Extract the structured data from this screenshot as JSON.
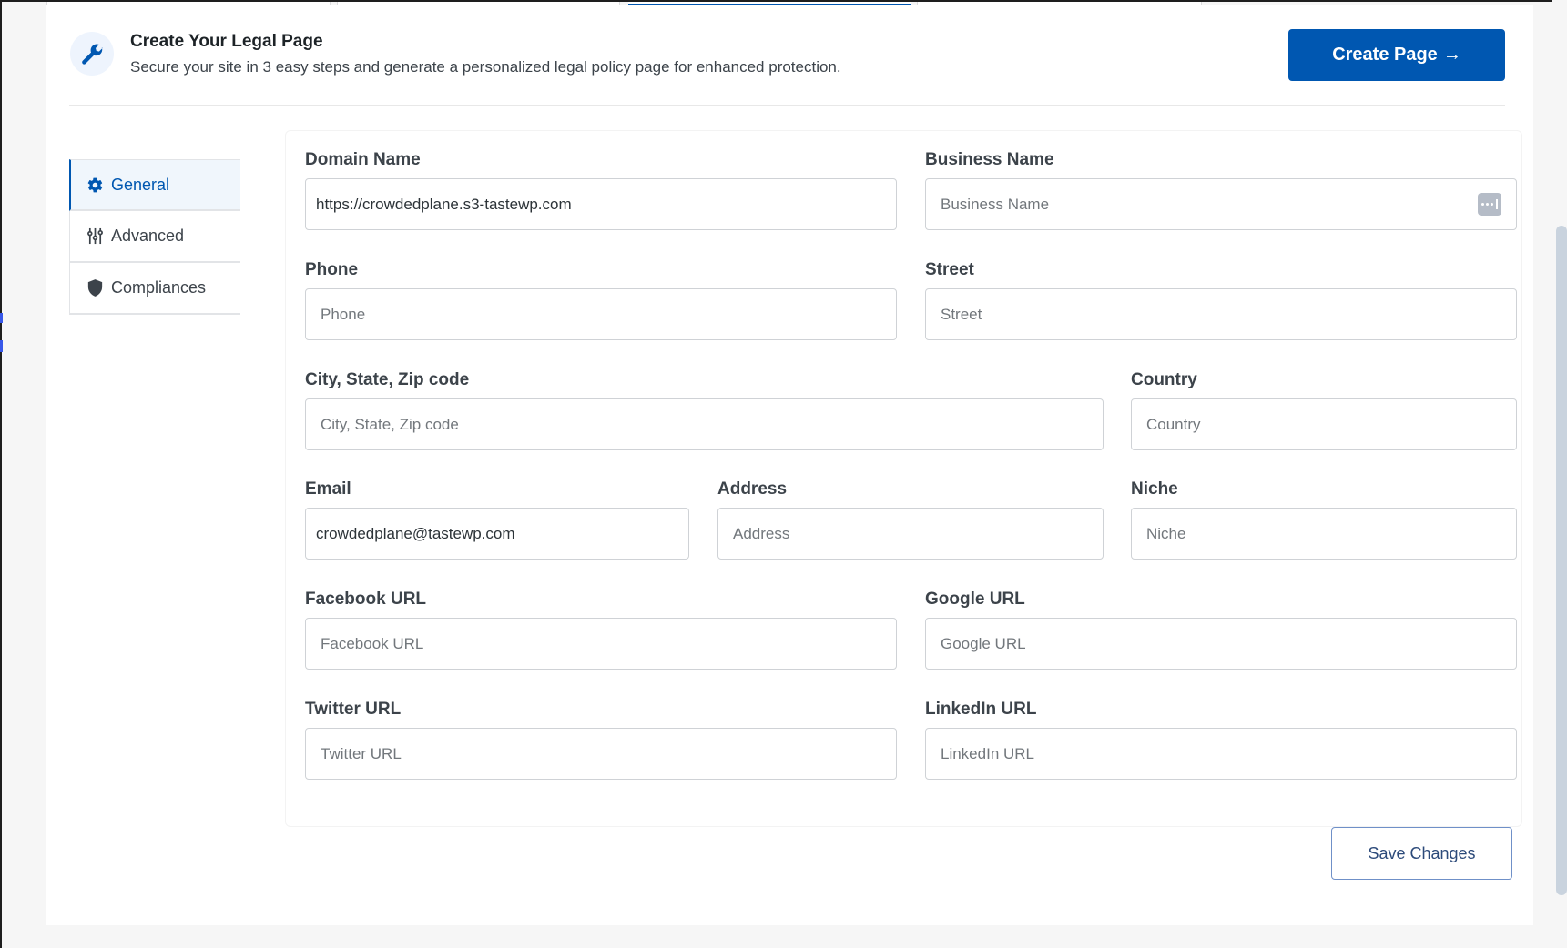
{
  "top_tabs": [
    {
      "label": "",
      "active": false
    },
    {
      "label": "",
      "active": false
    },
    {
      "label": "",
      "active": true
    },
    {
      "label": "",
      "active": false
    }
  ],
  "header": {
    "icon": "wrench-icon",
    "title": "Create Your Legal Page",
    "subtitle": "Secure your site in 3 easy steps and generate a personalized legal policy page for enhanced protection.",
    "create_button": "Create Page",
    "create_button_arrow": "→"
  },
  "sidebar": {
    "items": [
      {
        "label": "General",
        "icon": "gear-icon",
        "active": true
      },
      {
        "label": "Advanced",
        "icon": "sliders-icon",
        "active": false
      },
      {
        "label": "Compliances",
        "icon": "shield-icon",
        "active": false
      }
    ]
  },
  "form": {
    "domain_name": {
      "label": "Domain Name",
      "value": "https://crowdedplane.s3-tastewp.com",
      "placeholder": "Domain Name"
    },
    "business_name": {
      "label": "Business Name",
      "value": "",
      "placeholder": "Business Name"
    },
    "phone": {
      "label": "Phone",
      "value": "",
      "placeholder": "Phone"
    },
    "street": {
      "label": "Street",
      "value": "",
      "placeholder": "Street"
    },
    "city": {
      "label": "City, State, Zip code",
      "value": "",
      "placeholder": "City, State, Zip code"
    },
    "country": {
      "label": "Country",
      "value": "",
      "placeholder": "Country"
    },
    "email": {
      "label": "Email",
      "value": "crowdedplane@tastewp.com",
      "placeholder": "Email"
    },
    "address": {
      "label": "Address",
      "value": "",
      "placeholder": "Address"
    },
    "niche": {
      "label": "Niche",
      "value": "",
      "placeholder": "Niche"
    },
    "facebook": {
      "label": "Facebook URL",
      "value": "",
      "placeholder": "Facebook URL"
    },
    "google": {
      "label": "Google URL",
      "value": "",
      "placeholder": "Google URL"
    },
    "twitter": {
      "label": "Twitter URL",
      "value": "",
      "placeholder": "Twitter URL"
    },
    "linkedin": {
      "label": "LinkedIn URL",
      "value": "",
      "placeholder": "LinkedIn URL"
    }
  },
  "save_button": "Save Changes",
  "colors": {
    "accent": "#0057b1",
    "sidebar_active_bg": "#f0f6fc",
    "page_bg": "#f6f6f6"
  }
}
